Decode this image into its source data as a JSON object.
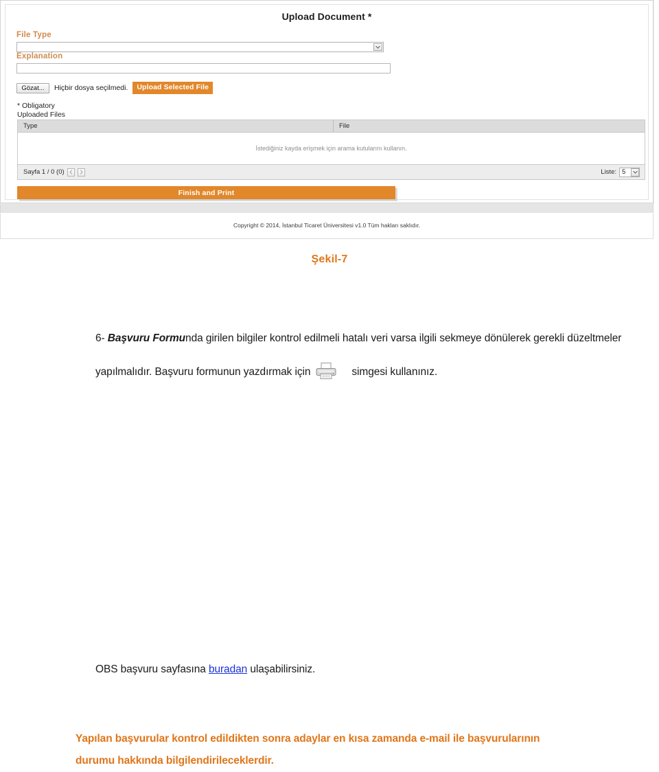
{
  "screenshot": {
    "form": {
      "title": "Upload Document *",
      "file_type_label": "File Type",
      "file_type_value": "",
      "explanation_label": "Explanation",
      "explanation_value": "",
      "browse_button": "Gözat...",
      "no_file_selected": "Hiçbir dosya seçilmedi.",
      "upload_button": "Upload Selected File",
      "obligatory_note": "* Obligatory",
      "uploaded_files_label": "Uploaded Files",
      "finish_button": "Finish and Print"
    },
    "table": {
      "columns": [
        "Type",
        "File"
      ],
      "rows": [],
      "empty_message": "İstediğiniz kayda erişmek için arama kutularını kullanın.",
      "pager_text": "Sayfa 1 / 0 (0)",
      "prev_label": "‹",
      "next_label": "›",
      "list_label": "Liste:",
      "list_value": "5"
    },
    "footer": {
      "copyright": "Copyright © 2014, İstanbul Ticaret Üniversitesi v1.0 Tüm hakları saklıdır."
    },
    "colors": {
      "accent_orange": "#e2872a",
      "label_orange": "#d2894a"
    }
  },
  "document": {
    "figure_caption": "Şekil-7",
    "paragraph_6": {
      "number": "6- ",
      "emphasis": "Başvuru Formu",
      "text_after_emphasis": "nda girilen bilgiler kontrol edilmeli hatalı veri varsa ilgili sekmeye dönülerek gerekli düzeltmeler yapılmalıdır. Başvuru formunun yazdırmak için",
      "text_after_icon": "simgesi kullanınız."
    },
    "paragraph_link": {
      "before": "OBS başvuru sayfasına ",
      "link_text": "buradan",
      "after": " ulaşabilirsiniz."
    },
    "notice": {
      "line1": "Yapılan başvurular kontrol edildikten sonra adaylar en kısa zamanda e-mail ile başvurularının",
      "line2": "durumu hakkında bilgilendirileceklerdir."
    },
    "colors": {
      "caption_orange": "#e0761a",
      "link_blue": "#1a33d6"
    }
  }
}
